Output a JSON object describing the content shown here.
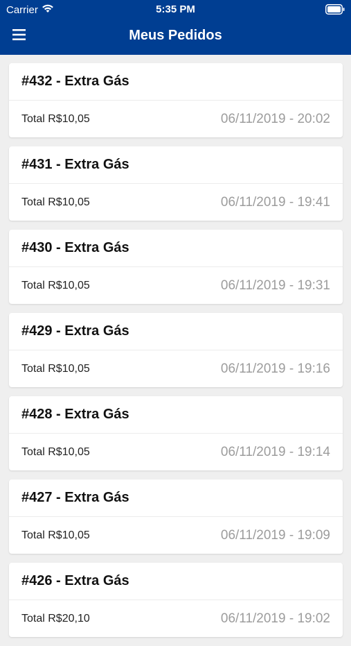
{
  "status_bar": {
    "carrier": "Carrier",
    "time": "5:35 PM"
  },
  "nav": {
    "title": "Meus Pedidos",
    "menu_icon": "hamburger-menu-icon"
  },
  "colors": {
    "header": "#003e92",
    "background": "#efefef",
    "card": "#ffffff",
    "date_text": "#9c9c9c"
  },
  "orders": [
    {
      "title": "#432 - Extra Gás",
      "total": "Total R$10,05",
      "date": "06/11/2019 - 20:02"
    },
    {
      "title": "#431 - Extra Gás",
      "total": "Total R$10,05",
      "date": "06/11/2019 - 19:41"
    },
    {
      "title": "#430 - Extra Gás",
      "total": "Total R$10,05",
      "date": "06/11/2019 - 19:31"
    },
    {
      "title": "#429 - Extra Gás",
      "total": "Total R$10,05",
      "date": "06/11/2019 - 19:16"
    },
    {
      "title": "#428 - Extra Gás",
      "total": "Total R$10,05",
      "date": "06/11/2019 - 19:14"
    },
    {
      "title": "#427 - Extra Gás",
      "total": "Total R$10,05",
      "date": "06/11/2019 - 19:09"
    },
    {
      "title": "#426 - Extra Gás",
      "total": "Total R$20,10",
      "date": "06/11/2019 - 19:02"
    }
  ]
}
